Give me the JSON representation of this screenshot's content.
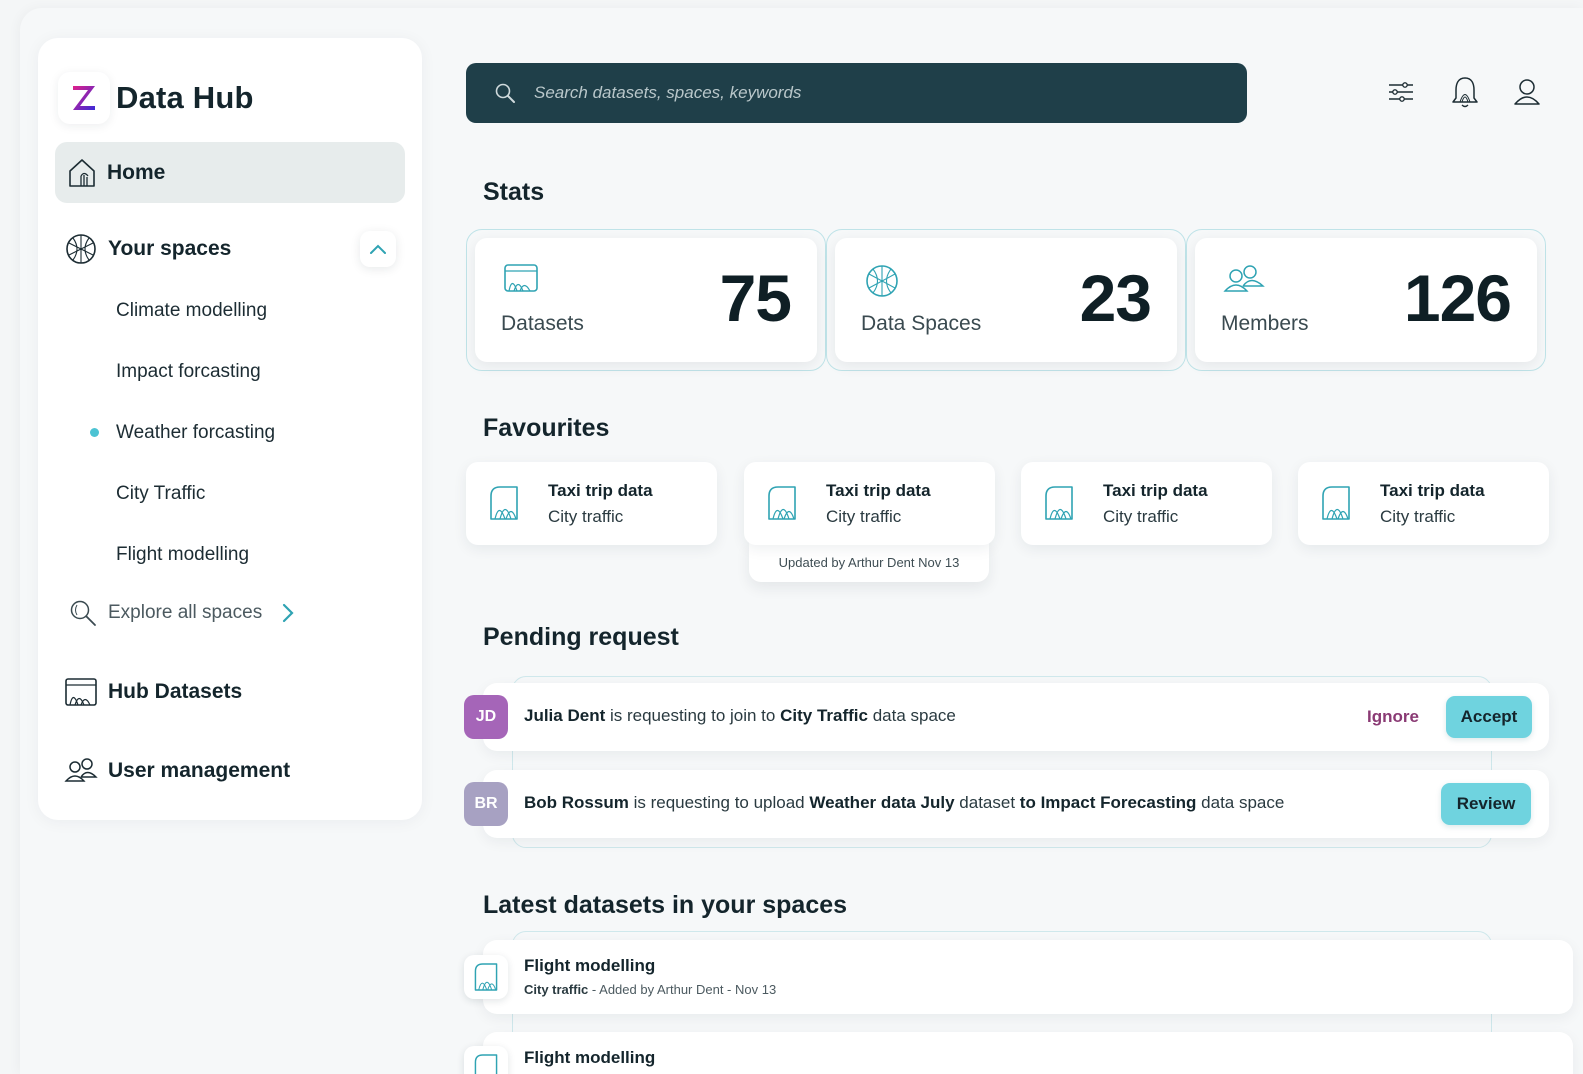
{
  "brand": {
    "title": "Data Hub",
    "logo_letter": "Z"
  },
  "nav": {
    "home": "Home",
    "your_spaces": "Your spaces",
    "spaces": [
      "Climate modelling",
      "Impact forcasting",
      "Weather forcasting",
      "City Traffic",
      "Flight modelling"
    ],
    "active_space_index": 2,
    "explore": "Explore all spaces",
    "hub_datasets": "Hub Datasets",
    "user_management": "User management"
  },
  "search": {
    "placeholder": "Search datasets, spaces, keywords"
  },
  "sections": {
    "stats": "Stats",
    "favourites": "Favourites",
    "pending": "Pending request",
    "latest": "Latest datasets in your spaces"
  },
  "stats": [
    {
      "label": "Datasets",
      "value": "75"
    },
    {
      "label": "Data Spaces",
      "value": "23"
    },
    {
      "label": "Members",
      "value": "126"
    }
  ],
  "favourites": [
    {
      "title": "Taxi trip data",
      "subtitle": "City traffic"
    },
    {
      "title": "Taxi trip data",
      "subtitle": "City traffic"
    },
    {
      "title": "Taxi trip data",
      "subtitle": "City traffic"
    },
    {
      "title": "Taxi trip data",
      "subtitle": "City traffic"
    }
  ],
  "favourite_tooltip": "Updated by Arthur Dent Nov 13",
  "requests": [
    {
      "initials": "JD",
      "avatar_color": "#a565b8",
      "name": "Julia Dent",
      "t1": "is requesting to join to",
      "target": "City Traffic",
      "t2": "data space",
      "ignore": "Ignore",
      "action": "Accept"
    },
    {
      "initials": "BR",
      "avatar_color": "#a7a1c2",
      "name": "Bob Rossum",
      "t1": "is requesting to upload",
      "dataset": "Weather data July",
      "t2": "dataset",
      "to": "to Impact Forecasting",
      "t3": "data space",
      "action": "Review"
    }
  ],
  "latest": [
    {
      "title": "Flight modelling",
      "space": "City traffic",
      "meta": "- Added by Arthur Dent - Nov 13"
    },
    {
      "title": "Flight modelling"
    }
  ],
  "colors": {
    "accent": "#6fd3df",
    "search_bg": "#1f3f49",
    "ignore": "#8a3a74",
    "icon_teal": "#2fa3b3"
  }
}
